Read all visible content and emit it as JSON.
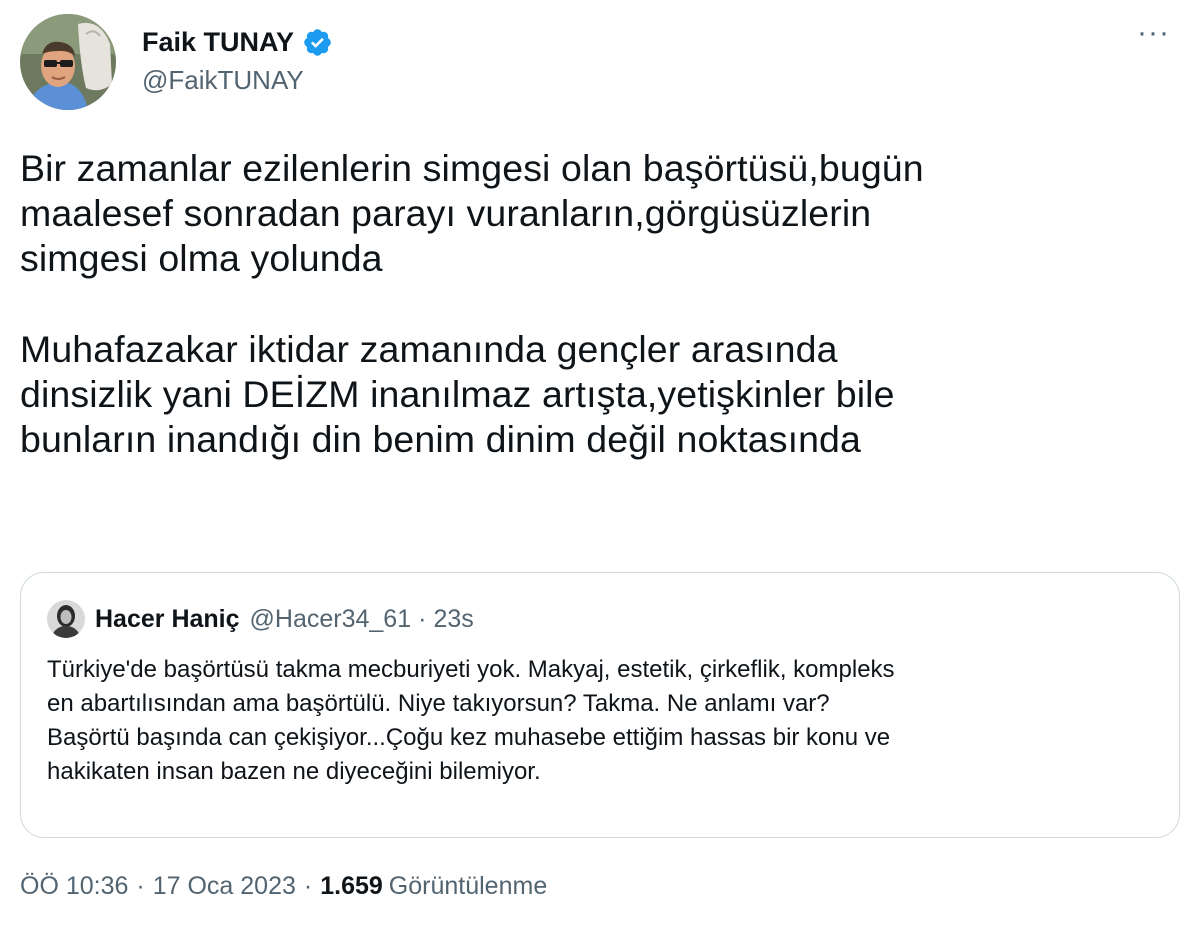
{
  "author": {
    "display_name": "Faik TUNAY",
    "handle": "@FaikTUNAY",
    "verified": true
  },
  "more_label": "···",
  "tweet": {
    "paragraphs": [
      [
        "Bir zamanlar ezilenlerin simgesi olan başörtüsü,bugün",
        "maalesef sonradan parayı vuranların,görgüsüzlerin",
        "simgesi olma yolunda"
      ],
      [
        "Muhafazakar iktidar zamanında gençler arasında",
        "dinsizlik yani DEİZM inanılmaz artışta,yetişkinler bile",
        "bunların inandığı din benim dinim değil noktasında"
      ]
    ]
  },
  "quote": {
    "display_name": "Hacer Haniç",
    "handle": "@Hacer34_61",
    "separator": "·",
    "time": "23s",
    "lines": [
      "Türkiye'de başörtüsü takma mecburiyeti yok. Makyaj, estetik, çirkeflik, kompleks",
      "en abartılısından ama başörtülü. Niye takıyorsun? Takma. Ne anlamı var?",
      "Başörtü başında can çekişiyor...Çoğu kez muhasebe ettiğim hassas bir konu ve",
      "hakikaten insan bazen ne diyeceğini bilemiyor."
    ]
  },
  "meta": {
    "time": "ÖÖ 10:36",
    "separator": "·",
    "date": "17 Oca 2023",
    "views_count": "1.659",
    "views_label": "Görüntülenme"
  },
  "colors": {
    "text_primary": "#0f1419",
    "text_secondary": "#536471",
    "verified_blue": "#1d9bf0",
    "border": "#cfd9de"
  }
}
